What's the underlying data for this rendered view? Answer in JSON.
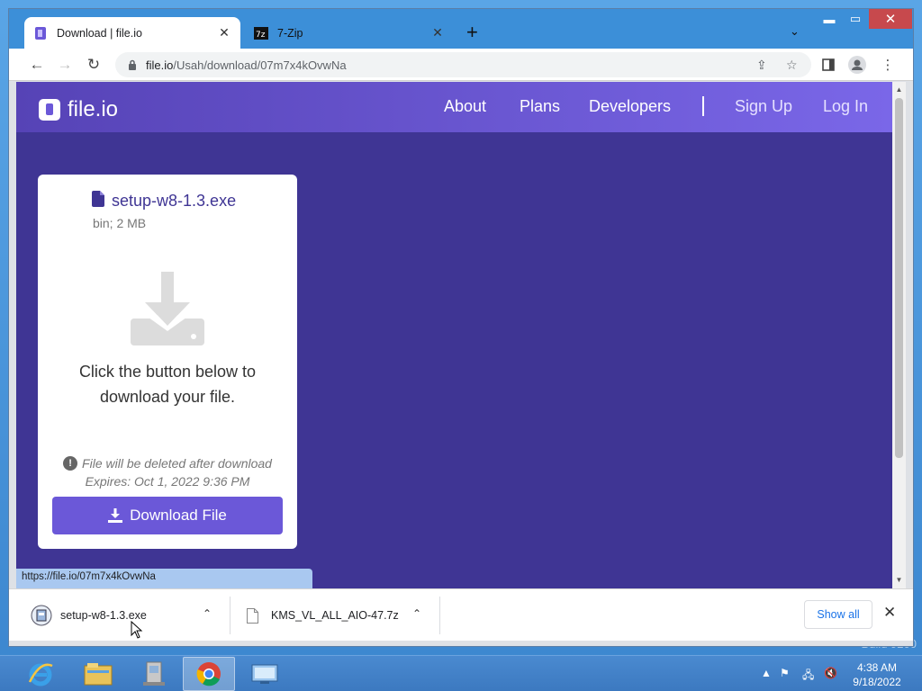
{
  "browser": {
    "tabs": [
      {
        "title": "Download | file.io",
        "active": true
      },
      {
        "title": "7-Zip",
        "active": false
      }
    ],
    "address": {
      "host": "file.io",
      "path": "/Usah/download/07m7x4kOvwNa"
    },
    "status_url": "https://file.io/07m7x4kOvwNa"
  },
  "site": {
    "logo_text": "file.io",
    "nav": {
      "about": "About",
      "plans": "Plans",
      "developers": "Developers",
      "signup": "Sign Up",
      "login": "Log In"
    }
  },
  "card": {
    "file_name": "setup-w8-1.3.exe",
    "file_meta": "bin; 2 MB",
    "message_line1": "Click the button below to",
    "message_line2": "download your file.",
    "warning": "File will be deleted after download",
    "expires": "Expires: Oct 1, 2022 9:36 PM",
    "download_label": "Download File"
  },
  "downloads": {
    "items": [
      {
        "name": "setup-w8-1.3.exe"
      },
      {
        "name": "KMS_VL_ALL_AIO-47.7z"
      }
    ],
    "show_all": "Show all"
  },
  "taskbar": {
    "time": "4:38 AM",
    "date": "9/18/2022"
  },
  "desktop": {
    "build_text": "Build 9200"
  },
  "colors": {
    "brand": "#6b58d8",
    "page_bg": "#3f3594",
    "header_from": "#5643b6",
    "header_to": "#7a67e8"
  }
}
